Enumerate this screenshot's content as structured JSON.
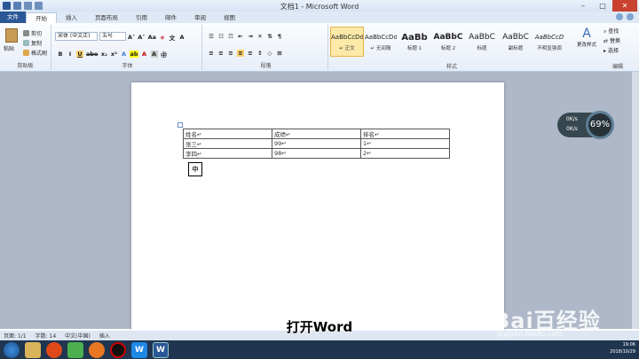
{
  "window": {
    "title": "文档1 - Microsoft Word"
  },
  "tabs": [
    "文件",
    "开始",
    "插入",
    "页面布局",
    "引用",
    "邮件",
    "审阅",
    "视图"
  ],
  "clipboard": {
    "paste": "粘贴",
    "cut": "剪切",
    "copy": "复制",
    "format_painter": "格式刷",
    "label": "剪贴板"
  },
  "font": {
    "name": "宋体 (中文正)",
    "size": "五号",
    "bold": "B",
    "italic": "I",
    "underline": "U",
    "strike": "abe",
    "sub": "x₂",
    "sup": "x²",
    "grow": "A˄",
    "shrink": "A˅",
    "case": "Aa",
    "label": "字体"
  },
  "paragraph": {
    "label": "段落"
  },
  "styles": {
    "label": "样式",
    "items": [
      {
        "preview": "AaBbCcDd",
        "name": "↵ 正文"
      },
      {
        "preview": "AaBbCcDd",
        "name": "↵ 无间隔"
      },
      {
        "preview": "AaBb",
        "name": "标题 1"
      },
      {
        "preview": "AaBbC",
        "name": "标题 2"
      },
      {
        "preview": "AaBbC",
        "name": "标题"
      },
      {
        "preview": "AaBbC",
        "name": "副标题"
      },
      {
        "preview": "AaBbCcD",
        "name": "不明显强调"
      }
    ],
    "change": "更改样式"
  },
  "editing": {
    "find": "查找",
    "replace": "替换",
    "select": "选择",
    "label": "编辑"
  },
  "document": {
    "table": [
      [
        "姓名↵",
        "成绩↵",
        "排名↵"
      ],
      [
        "张三↵",
        "99↵",
        "1↵"
      ],
      [
        "李四↵",
        "98↵",
        "2↵"
      ]
    ],
    "ime_char": "中"
  },
  "gadget": {
    "percent": "69%",
    "up": "0K/s",
    "down": "0K/s"
  },
  "status": {
    "page": "页面: 1/1",
    "words": "字数: 14",
    "lang": "中文(中国)",
    "mode": "插入"
  },
  "subtitle": "打开Word",
  "watermark": {
    "main": "Bai百经验",
    "sub": "jingyan.baidu.com"
  },
  "tray": {
    "time": "19:06",
    "date": "2018/10/29"
  }
}
